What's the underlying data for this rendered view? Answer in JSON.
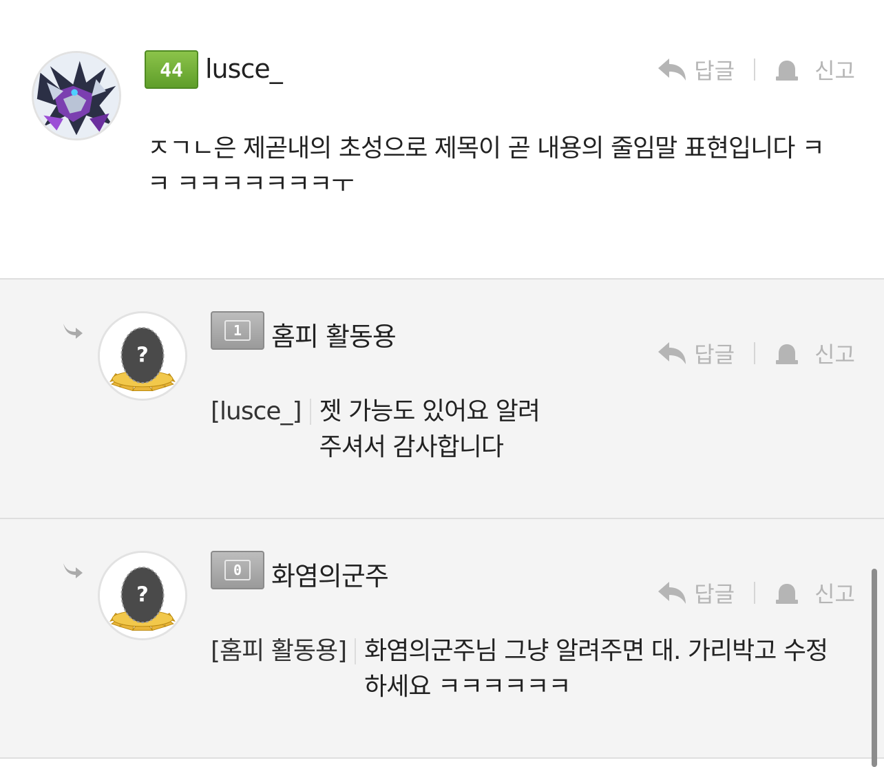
{
  "comments": [
    {
      "level": "44",
      "username": "lusce_",
      "reply_label": "답글",
      "report_label": "신고",
      "text": "ㅈㄱㄴ은 제곧내의 초성으로 제목이 곧 내용의 줄임말 표현입니다 ㅋㅋ ㅋㅋㅋㅋㅋㅋㅋㅜ"
    },
    {
      "level": "1",
      "username": "홈피 활동용",
      "reply_label": "답글",
      "report_label": "신고",
      "mention": "[lusce_]",
      "text": "젯 가능도 있어요 알려주셔서 감사합니다"
    },
    {
      "level": "0",
      "username": "화염의군주",
      "reply_label": "답글",
      "report_label": "신고",
      "mention": "[홈피 활동용]",
      "text": "화염의군주님 그냥 알려주면 대. 가리박고 수정하세요 ㅋㅋㅋㅋㅋㅋ"
    }
  ],
  "icons": {
    "reply": "reply-arrow-icon",
    "report": "siren-icon",
    "nested": "nested-reply-arrow-icon",
    "default_avatar": "egg-question-avatar"
  },
  "colors": {
    "level_green": "#6aa832",
    "level_gray": "#a5a5a5",
    "action_gray": "#b5b5b5",
    "reply_background": "#f4f4f4"
  }
}
